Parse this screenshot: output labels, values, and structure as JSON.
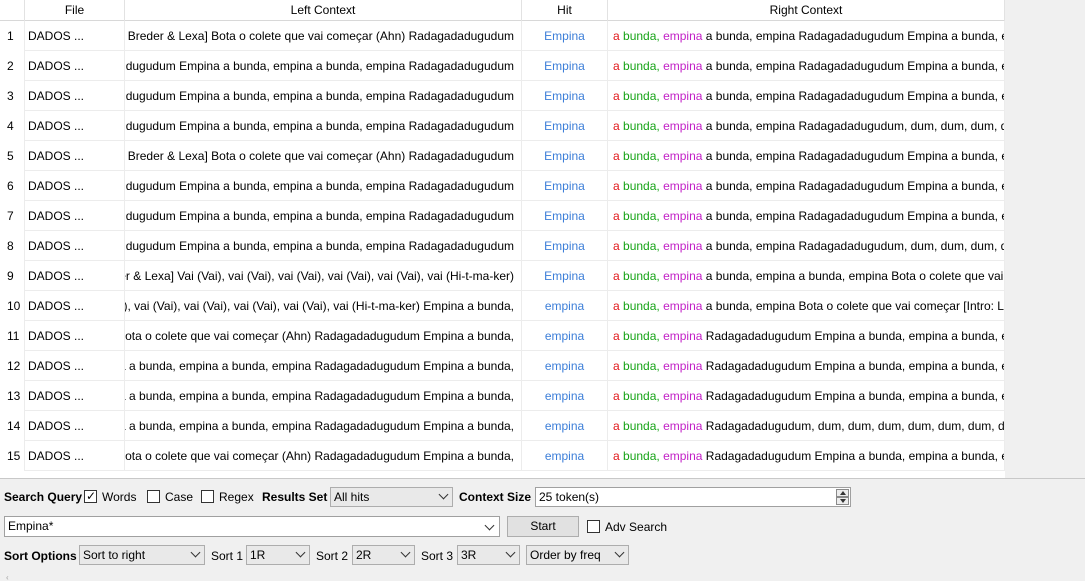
{
  "table": {
    "headers": [
      "File",
      "Left Context",
      "Hit",
      "Right Context"
    ],
    "rows": [
      {
        "num": "1",
        "file": "DADOS ...",
        "left": "e Breder & Lexa] Bota o colete que vai começar (Ahn) Radagadadugudum",
        "hit": "Empina",
        "r1": "a",
        "r2": "bunda,",
        "r3": "empina",
        "rest": "a bunda, empina Radagadadugudum Empina a bunda, e"
      },
      {
        "num": "2",
        "file": "DADOS ...",
        "left": "dugudum Empina a bunda, empina a bunda, empina Radagadadugudum",
        "hit": "Empina",
        "r1": "a",
        "r2": "bunda,",
        "r3": "empina",
        "rest": "a bunda, empina Radagadadugudum Empina a bunda, e"
      },
      {
        "num": "3",
        "file": "DADOS ...",
        "left": "dugudum Empina a bunda, empina a bunda, empina Radagadadugudum",
        "hit": "Empina",
        "r1": "a",
        "r2": "bunda,",
        "r3": "empina",
        "rest": "a bunda, empina Radagadadugudum Empina a bunda, e"
      },
      {
        "num": "4",
        "file": "DADOS ...",
        "left": "dugudum Empina a bunda, empina a bunda, empina Radagadadugudum",
        "hit": "Empina",
        "r1": "a",
        "r2": "bunda,",
        "r3": "empina",
        "rest": "a bunda, empina Radagadadugudum, dum, dum, dum, d"
      },
      {
        "num": "5",
        "file": "DADOS ...",
        "left": "e Breder & Lexa] Bota o colete que vai começar (Ahn) Radagadadugudum",
        "hit": "Empina",
        "r1": "a",
        "r2": "bunda,",
        "r3": "empina",
        "rest": "a bunda, empina Radagadadugudum Empina a bunda, e"
      },
      {
        "num": "6",
        "file": "DADOS ...",
        "left": "dugudum Empina a bunda, empina a bunda, empina Radagadadugudum",
        "hit": "Empina",
        "r1": "a",
        "r2": "bunda,",
        "r3": "empina",
        "rest": "a bunda, empina Radagadadugudum Empina a bunda, e"
      },
      {
        "num": "7",
        "file": "DADOS ...",
        "left": "dugudum Empina a bunda, empina a bunda, empina Radagadadugudum",
        "hit": "Empina",
        "r1": "a",
        "r2": "bunda,",
        "r3": "empina",
        "rest": "a bunda, empina Radagadadugudum Empina a bunda, e"
      },
      {
        "num": "8",
        "file": "DADOS ...",
        "left": "dugudum Empina a bunda, empina a bunda, empina Radagadadugudum",
        "hit": "Empina",
        "r1": "a",
        "r2": "bunda,",
        "r3": "empina",
        "rest": "a bunda, empina Radagadadugudum, dum, dum, dum, d"
      },
      {
        "num": "9",
        "file": "DADOS ...",
        "left": "ker & Lexa] Vai (Vai), vai (Vai), vai (Vai), vai (Vai), vai (Vai), vai (Hi-t-ma-ker)",
        "hit": "Empina",
        "r1": "a",
        "r2": "bunda,",
        "r3": "empina",
        "rest": "a bunda, empina a bunda, empina Bota o colete que vai c"
      },
      {
        "num": "10",
        "file": "DADOS ...",
        "left": "ai), vai (Vai), vai (Vai), vai (Vai), vai (Vai), vai (Hi-t-ma-ker) Empina a bunda,",
        "hit": "empina",
        "r1": "a",
        "r2": "bunda,",
        "r3": "empina",
        "rest": "a bunda, empina Bota o colete que vai começar [Intro: Le"
      },
      {
        "num": "11",
        "file": "DADOS ...",
        "left": "Bota o colete que vai começar (Ahn) Radagadadugudum Empina a bunda,",
        "hit": "empina",
        "r1": "a",
        "r2": "bunda,",
        "r3": "empina",
        "rest": "Radagadadugudum Empina a bunda, empina a bunda, e"
      },
      {
        "num": "12",
        "file": "DADOS ...",
        "left": "a a bunda, empina a bunda, empina Radagadadugudum Empina a bunda,",
        "hit": "empina",
        "r1": "a",
        "r2": "bunda,",
        "r3": "empina",
        "rest": "Radagadadugudum Empina a bunda, empina a bunda, e"
      },
      {
        "num": "13",
        "file": "DADOS ...",
        "left": "a a bunda, empina a bunda, empina Radagadadugudum Empina a bunda,",
        "hit": "empina",
        "r1": "a",
        "r2": "bunda,",
        "r3": "empina",
        "rest": "Radagadadugudum Empina a bunda, empina a bunda, e"
      },
      {
        "num": "14",
        "file": "DADOS ...",
        "left": "a a bunda, empina a bunda, empina Radagadadugudum Empina a bunda,",
        "hit": "empina",
        "r1": "a",
        "r2": "bunda,",
        "r3": "empina",
        "rest": "Radagadadugudum, dum, dum, dum, dum, dum, dum, d"
      },
      {
        "num": "15",
        "file": "DADOS ...",
        "left": "Bota o colete que vai começar (Ahn) Radagadadugudum Empina a bunda,",
        "hit": "empina",
        "r1": "a",
        "r2": "bunda,",
        "r3": "empina",
        "rest": "Radagadadugudum Empina a bunda, empina a bunda, e"
      }
    ]
  },
  "search": {
    "query_label": "Search Query",
    "words_label": "Words",
    "words_checked": true,
    "case_label": "Case",
    "case_checked": false,
    "regex_label": "Regex",
    "regex_checked": false,
    "results_set_label": "Results Set",
    "results_set_value": "All hits",
    "context_size_label": "Context Size",
    "context_size_value": "25 token(s)",
    "query_value": "Empina*",
    "start_label": "Start",
    "adv_search_label": "Adv Search",
    "adv_search_checked": false
  },
  "sort": {
    "options_label": "Sort Options",
    "options_value": "Sort to right",
    "sort1_label": "Sort 1",
    "sort1_value": "1R",
    "sort2_label": "Sort 2",
    "sort2_value": "2R",
    "sort3_label": "Sort 3",
    "sort3_value": "3R",
    "order_value": "Order by freq"
  },
  "colors": {
    "hit": "#3c7ed8",
    "token1": "#e0181b",
    "token2": "#18a418",
    "token3": "#c21fc6"
  }
}
